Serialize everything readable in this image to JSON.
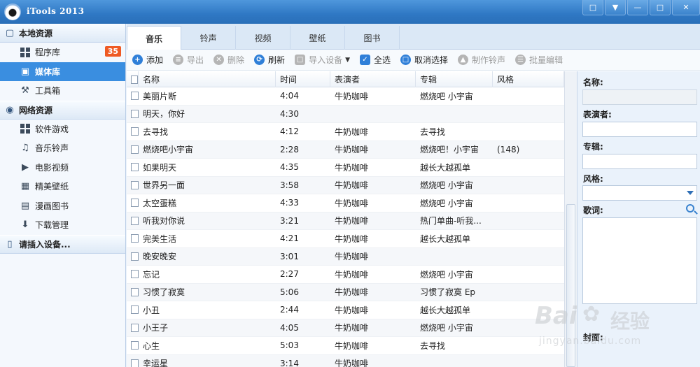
{
  "app": {
    "title": "iTools 2013"
  },
  "sidebar": {
    "local_section": "本地资源",
    "local_items": [
      {
        "label": "程序库",
        "badge": "35",
        "icon": "apps-grid-icon"
      },
      {
        "label": "媒体库",
        "icon": "film-icon",
        "active": true
      },
      {
        "label": "工具箱",
        "icon": "wrench-icon"
      }
    ],
    "network_section": "网络资源",
    "network_items": [
      {
        "label": "软件游戏",
        "icon": "apps-grid-icon"
      },
      {
        "label": "音乐铃声",
        "icon": "music-note-icon"
      },
      {
        "label": "电影视频",
        "icon": "video-icon"
      },
      {
        "label": "精美壁纸",
        "icon": "picture-icon"
      },
      {
        "label": "漫画图书",
        "icon": "book-icon"
      },
      {
        "label": "下载管理",
        "icon": "download-icon"
      }
    ],
    "device_section": "请插入设备..."
  },
  "tabs": [
    "音乐",
    "铃声",
    "视频",
    "壁纸",
    "图书"
  ],
  "toolbar": {
    "add": "添加",
    "export": "导出",
    "delete": "删除",
    "refresh": "刷新",
    "import_device": "导入设备",
    "select_all": "全选",
    "cancel_select": "取消选择",
    "make_ringtone": "制作铃声",
    "batch_edit": "批量编辑"
  },
  "table": {
    "headers": {
      "name": "名称",
      "time": "时间",
      "artist": "表演者",
      "album": "专辑",
      "genre": "风格"
    },
    "rows": [
      {
        "name": "美丽片断",
        "time": "4:04",
        "artist": "牛奶咖啡",
        "album": "燃烧吧 小宇宙",
        "genre": ""
      },
      {
        "name": "明天，你好",
        "time": "4:30",
        "artist": "",
        "album": "",
        "genre": ""
      },
      {
        "name": "去寻找",
        "time": "4:12",
        "artist": "牛奶咖啡",
        "album": "去寻找",
        "genre": ""
      },
      {
        "name": "燃烧吧小宇宙",
        "time": "2:28",
        "artist": "牛奶咖啡",
        "album": "燃烧吧！小宇宙",
        "genre": "(148)"
      },
      {
        "name": "如果明天",
        "time": "4:35",
        "artist": "牛奶咖啡",
        "album": "越长大越孤单",
        "genre": ""
      },
      {
        "name": "世界另一面",
        "time": "3:58",
        "artist": "牛奶咖啡",
        "album": "燃烧吧 小宇宙",
        "genre": ""
      },
      {
        "name": "太空蛋糕",
        "time": "4:33",
        "artist": "牛奶咖啡",
        "album": "燃烧吧 小宇宙",
        "genre": ""
      },
      {
        "name": "听我对你说",
        "time": "3:21",
        "artist": "牛奶咖啡",
        "album": "热门单曲-听我...",
        "genre": ""
      },
      {
        "name": "完美生活",
        "time": "4:21",
        "artist": "牛奶咖啡",
        "album": "越长大越孤单",
        "genre": ""
      },
      {
        "name": "晚安晚安",
        "time": "3:01",
        "artist": "牛奶咖啡",
        "album": "",
        "genre": ""
      },
      {
        "name": "忘记",
        "time": "2:27",
        "artist": "牛奶咖啡",
        "album": "燃烧吧 小宇宙",
        "genre": ""
      },
      {
        "name": "习惯了寂寞",
        "time": "5:06",
        "artist": "牛奶咖啡",
        "album": "习惯了寂寞 Ep",
        "genre": ""
      },
      {
        "name": "小丑",
        "time": "2:44",
        "artist": "牛奶咖啡",
        "album": "越长大越孤单",
        "genre": ""
      },
      {
        "name": "小王子",
        "time": "4:05",
        "artist": "牛奶咖啡",
        "album": "燃烧吧 小宇宙",
        "genre": ""
      },
      {
        "name": "心生",
        "time": "5:03",
        "artist": "牛奶咖啡",
        "album": "去寻找",
        "genre": ""
      },
      {
        "name": "幸运星",
        "time": "3:14",
        "artist": "牛奶咖啡",
        "album": "",
        "genre": ""
      }
    ]
  },
  "details": {
    "name_label": "名称:",
    "artist_label": "表演者:",
    "album_label": "专辑:",
    "genre_label": "风格:",
    "lyrics_label": "歌词:",
    "cover_label": "封面:"
  },
  "watermark": {
    "brand": "Bai",
    "brand2": "经验",
    "url": "jingyan.baidu.com"
  }
}
